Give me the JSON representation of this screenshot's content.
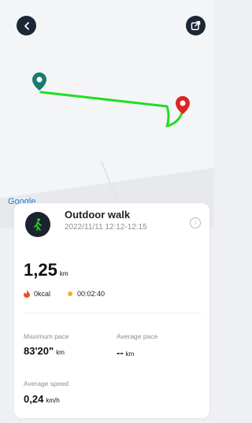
{
  "header": {
    "back_icon": "chevron-left-icon",
    "share_icon": "share-icon"
  },
  "map": {
    "partial_label": "Google",
    "route_color": "#22dd22",
    "start_marker_color": "#1a7a6e",
    "end_marker_color": "#e02424"
  },
  "activity": {
    "title": "Outdoor walk",
    "datetime": "2022/11/11 12:12-12:15",
    "icon": "walking-person-icon",
    "info_icon": "info-icon"
  },
  "distance": {
    "value": "1,25",
    "unit": "km"
  },
  "calories": "0kcal",
  "duration": "00:02:40",
  "max_pace": {
    "label": "Maximum pace",
    "value": "83'20\"",
    "unit": "km"
  },
  "avg_pace": {
    "label": "Average pace",
    "value": "--",
    "unit": "km"
  },
  "avg_speed": {
    "label": "Average speed",
    "value": "0,24",
    "unit": "km/h"
  }
}
